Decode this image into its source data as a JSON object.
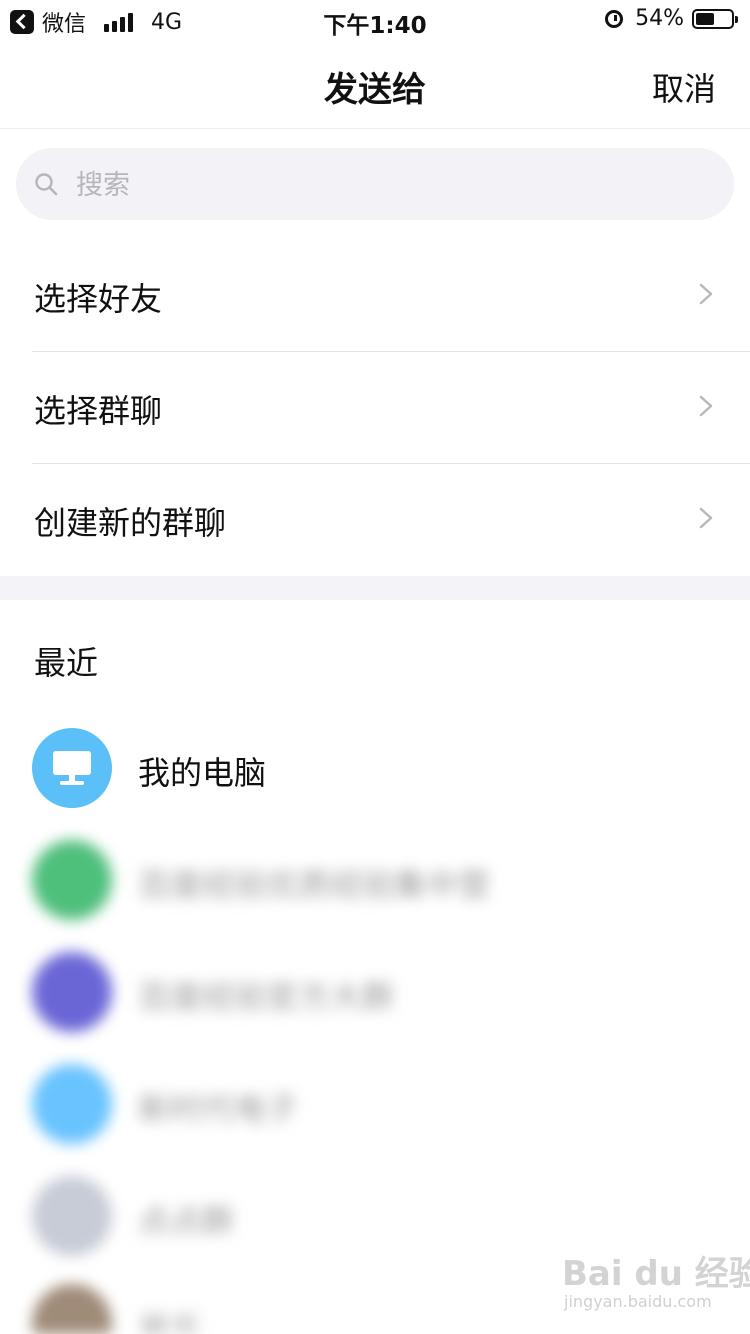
{
  "status_bar": {
    "back_app": "微信",
    "network": "4G",
    "time": "下午1:40",
    "battery": "54%",
    "battery_level": 0.54
  },
  "nav": {
    "title": "发送给",
    "cancel": "取消"
  },
  "search": {
    "placeholder": "搜索"
  },
  "menu": [
    {
      "label": "选择好友"
    },
    {
      "label": "选择群聊"
    },
    {
      "label": "创建新的群聊"
    }
  ],
  "recent": {
    "title": "最近",
    "contacts": [
      {
        "name": "我的电脑",
        "avatar_icon": "monitor-icon",
        "avatar_color": "#5ac0f7",
        "blurred": false
      },
      {
        "name": "百度经验优质经验集中营",
        "avatar_color": "#4fbf7c",
        "blurred": true
      },
      {
        "name": "百度经验官方大群",
        "avatar_color": "#6b66d6",
        "blurred": true
      },
      {
        "name": "新时代电子",
        "avatar_color": "#69c3ff",
        "blurred": true
      },
      {
        "name": "点点群",
        "avatar_color": "#c7ccd6",
        "blurred": true
      },
      {
        "name": "易乐",
        "avatar_color": "#a08a78",
        "blurred": true
      }
    ]
  },
  "watermark": {
    "text": "Bai du 经验",
    "sub": "jingyan.baidu.com"
  },
  "colors": {
    "accent_blue": "#5ac0f7",
    "search_bg": "#f2f2f7",
    "section_gap": "#f4f4f8"
  }
}
